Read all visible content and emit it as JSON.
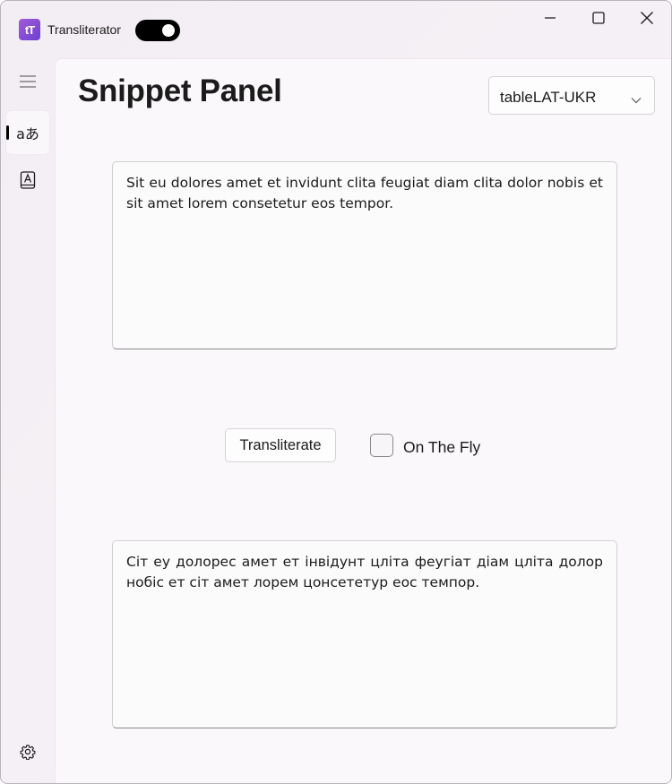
{
  "app": {
    "title": "Transliterator",
    "logo_text": "tT",
    "toggle_on": true
  },
  "window_controls": {
    "minimize_icon": "minimize-icon",
    "maximize_icon": "maximize-icon",
    "close_icon": "close-icon"
  },
  "nav": {
    "items": [
      {
        "name": "menu",
        "icon": "hamburger-icon"
      },
      {
        "name": "transliterate",
        "icon": "translate-icon",
        "glyph": "aあ",
        "selected": true
      },
      {
        "name": "dictionary",
        "icon": "dictionary-icon"
      }
    ],
    "footer": {
      "name": "settings",
      "icon": "gear-icon"
    }
  },
  "page": {
    "title": "Snippet Panel"
  },
  "table_select": {
    "value": "tableLAT-UKR"
  },
  "input": {
    "text": "Sit eu dolores amet et invidunt clita feugiat diam clita dolor nobis et sit amet lorem consetetur eos tempor."
  },
  "actions": {
    "transliterate_label": "Transliterate",
    "on_the_fly_label": "On The Fly",
    "on_the_fly_checked": false
  },
  "output": {
    "text": "Сіт еу долорес амет ет інвідунт цліта феугіат діам цліта долор нобіс ет сіт амет лорем цонсететур еос темпор."
  },
  "colors": {
    "accent_logo": "#7a45d6",
    "toggle_bg": "#000000"
  }
}
